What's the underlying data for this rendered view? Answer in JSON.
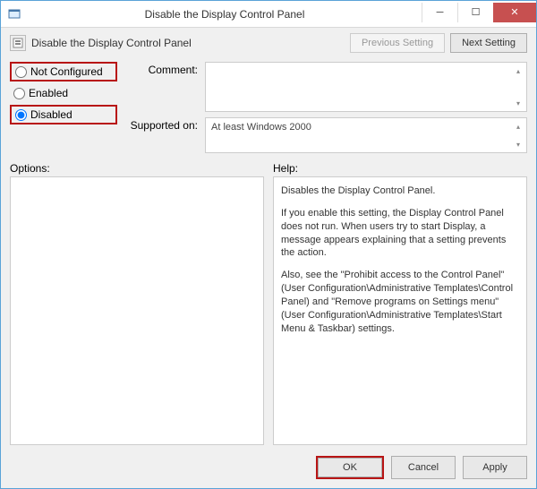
{
  "titlebar": {
    "title": "Disable the Display Control Panel",
    "icon": "policy-icon"
  },
  "header": {
    "policy_title": "Disable the Display Control Panel",
    "prev_btn": "Previous Setting",
    "next_btn": "Next Setting"
  },
  "radios": {
    "not_configured": "Not Configured",
    "enabled": "Enabled",
    "disabled": "Disabled",
    "selected": "disabled"
  },
  "fields": {
    "comment_label": "Comment:",
    "comment_value": "",
    "supported_label": "Supported on:",
    "supported_value": "At least Windows 2000"
  },
  "panels": {
    "options_label": "Options:",
    "help_label": "Help:",
    "help_p1": "Disables the Display Control Panel.",
    "help_p2": "If you enable this setting, the Display Control Panel does not run. When users try to start Display, a message appears explaining that a setting prevents the action.",
    "help_p3": "Also, see the \"Prohibit access to the Control Panel\" (User Configuration\\Administrative Templates\\Control Panel) and \"Remove programs on Settings menu\" (User Configuration\\Administrative Templates\\Start Menu & Taskbar) settings."
  },
  "buttons": {
    "ok": "OK",
    "cancel": "Cancel",
    "apply": "Apply"
  }
}
